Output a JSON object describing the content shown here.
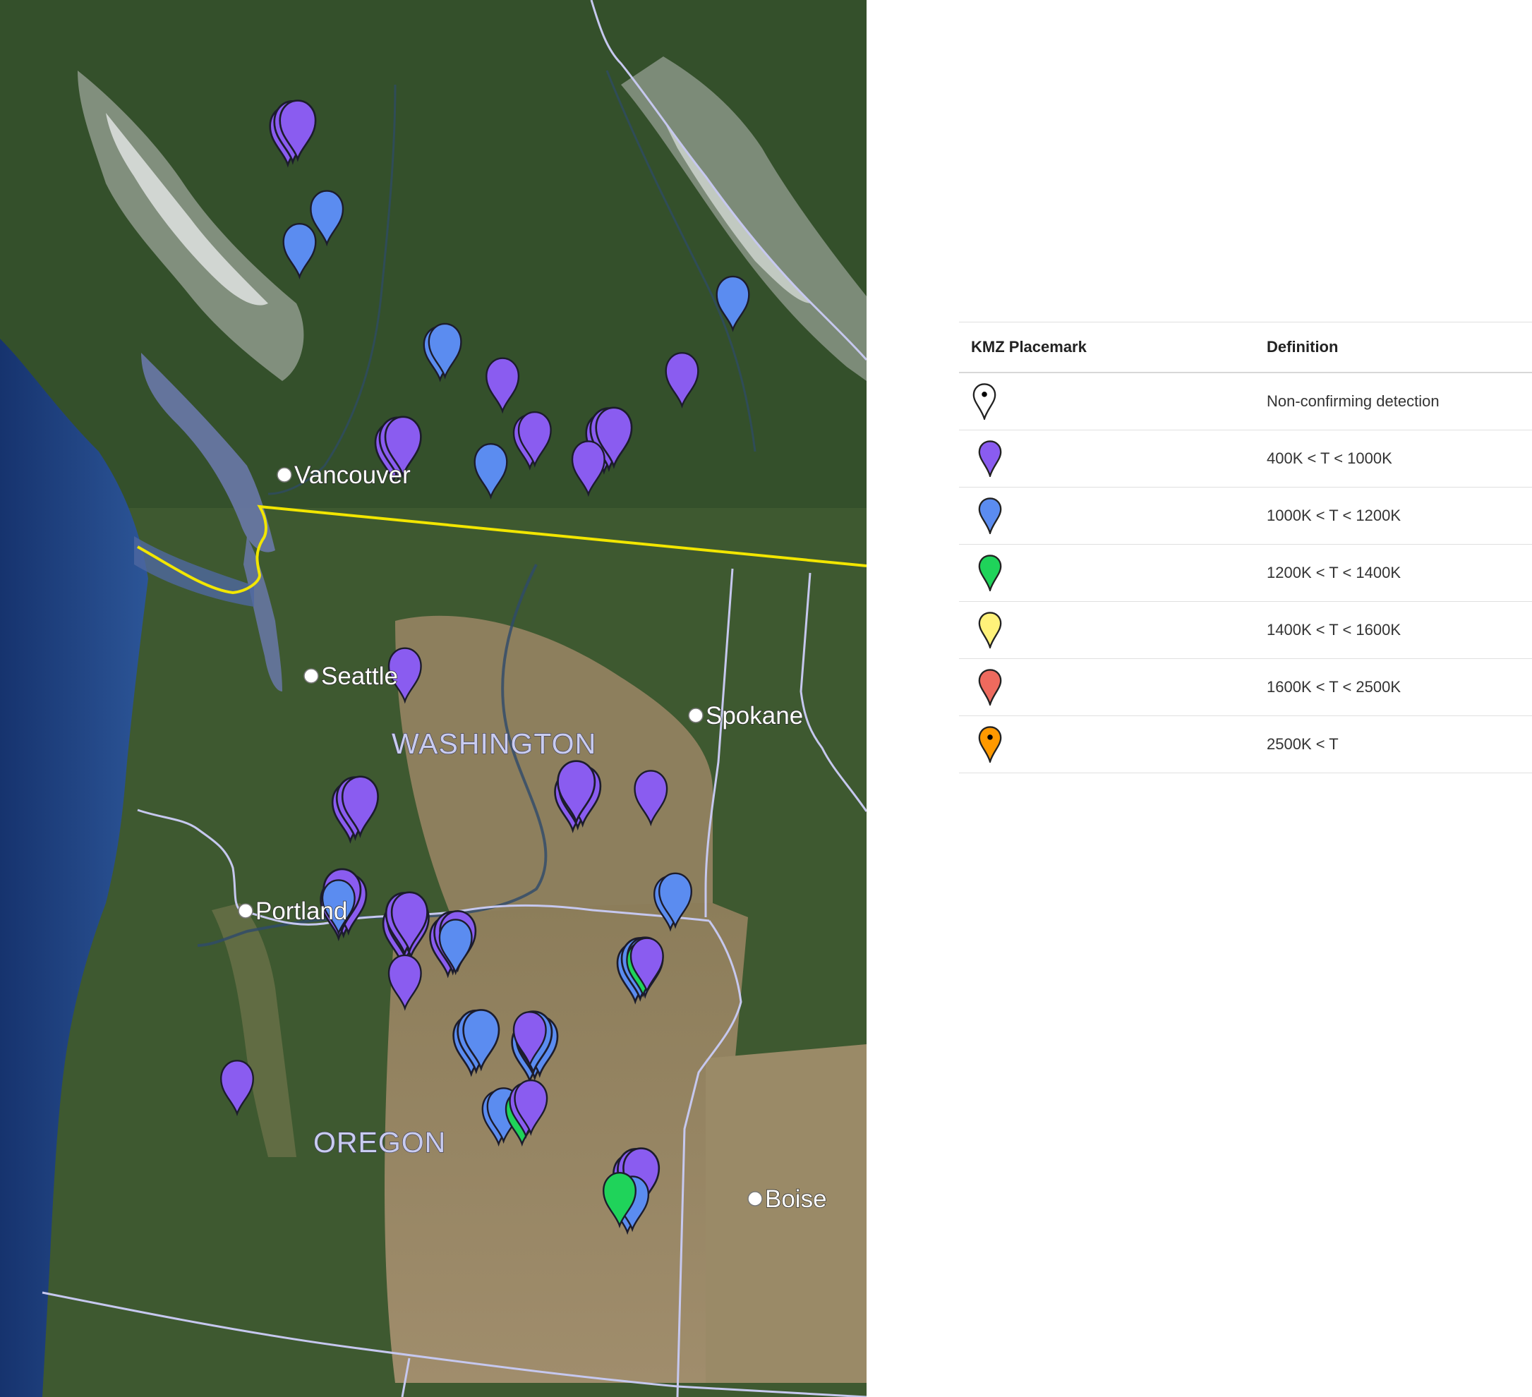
{
  "map": {
    "cities": [
      {
        "name": "Vancouver"
      },
      {
        "name": "Seattle"
      },
      {
        "name": "Spokane"
      },
      {
        "name": "Portland"
      },
      {
        "name": "Boise"
      }
    ],
    "states": [
      {
        "name": "WASHINGTON"
      },
      {
        "name": "OREGON"
      }
    ],
    "placemark_colors": {
      "purple": "#8a5cf0",
      "blue": "#5b8cf0",
      "green": "#1fd35a"
    },
    "placemarks": [
      {
        "lon": -123.05,
        "lat": 50.55,
        "cls": "purple",
        "count": 3
      },
      {
        "lon": -122.55,
        "lat": 49.95,
        "cls": "blue",
        "count": 1
      },
      {
        "lon": -122.9,
        "lat": 49.7,
        "cls": "blue",
        "count": 1
      },
      {
        "lon": -117.35,
        "lat": 49.3,
        "cls": "blue",
        "count": 1
      },
      {
        "lon": -121.1,
        "lat": 48.92,
        "cls": "blue",
        "count": 2
      },
      {
        "lon": -120.3,
        "lat": 48.68,
        "cls": "purple",
        "count": 1
      },
      {
        "lon": -118.0,
        "lat": 48.72,
        "cls": "purple",
        "count": 1
      },
      {
        "lon": -121.7,
        "lat": 48.15,
        "cls": "purple",
        "count": 3
      },
      {
        "lon": -119.95,
        "lat": 48.25,
        "cls": "purple",
        "count": 2
      },
      {
        "lon": -119.0,
        "lat": 48.22,
        "cls": "purple",
        "count": 3
      },
      {
        "lon": -120.45,
        "lat": 48.03,
        "cls": "blue",
        "count": 1
      },
      {
        "lon": -119.2,
        "lat": 48.05,
        "cls": "purple",
        "count": 1
      },
      {
        "lon": -121.55,
        "lat": 46.48,
        "cls": "purple",
        "count": 1
      },
      {
        "lon": -122.25,
        "lat": 45.42,
        "cls": "purple",
        "count": 3
      },
      {
        "lon": -119.4,
        "lat": 45.5,
        "cls": "purple",
        "count": 4
      },
      {
        "lon": -118.4,
        "lat": 45.55,
        "cls": "purple",
        "count": 1
      },
      {
        "lon": -122.4,
        "lat": 44.68,
        "cls": "purple",
        "count": 4
      },
      {
        "lon": -122.4,
        "lat": 44.72,
        "cls": "blue",
        "count": 1
      },
      {
        "lon": -121.6,
        "lat": 44.5,
        "cls": "purple",
        "count": 5
      },
      {
        "lon": -121.0,
        "lat": 44.4,
        "cls": "purple",
        "count": 3
      },
      {
        "lon": -120.9,
        "lat": 44.42,
        "cls": "blue",
        "count": 1
      },
      {
        "lon": -121.55,
        "lat": 44.15,
        "cls": "purple",
        "count": 1
      },
      {
        "lon": -118.15,
        "lat": 44.75,
        "cls": "blue",
        "count": 2
      },
      {
        "lon": -118.6,
        "lat": 44.2,
        "cls": "blue",
        "count": 3
      },
      {
        "lon": -118.5,
        "lat": 44.25,
        "cls": "green",
        "count": 1
      },
      {
        "lon": -118.45,
        "lat": 44.28,
        "cls": "purple",
        "count": 1
      },
      {
        "lon": -120.7,
        "lat": 43.65,
        "cls": "blue",
        "count": 3
      },
      {
        "lon": -119.95,
        "lat": 43.6,
        "cls": "blue",
        "count": 4
      },
      {
        "lon": -119.95,
        "lat": 43.72,
        "cls": "purple",
        "count": 1
      },
      {
        "lon": -120.35,
        "lat": 43.12,
        "cls": "blue",
        "count": 2
      },
      {
        "lon": -120.05,
        "lat": 43.12,
        "cls": "green",
        "count": 1
      },
      {
        "lon": -120.0,
        "lat": 43.18,
        "cls": "purple",
        "count": 2
      },
      {
        "lon": -118.65,
        "lat": 42.6,
        "cls": "purple",
        "count": 3
      },
      {
        "lon": -118.7,
        "lat": 42.45,
        "cls": "blue",
        "count": 2
      },
      {
        "lon": -118.8,
        "lat": 42.5,
        "cls": "green",
        "count": 1
      },
      {
        "lon": -123.7,
        "lat": 43.35,
        "cls": "purple",
        "count": 1
      }
    ]
  },
  "legend": {
    "col1_header": "KMZ Placemark",
    "col2_header": "Definition",
    "rows": [
      {
        "icon": "white-pin-icon",
        "color": "#ffffff",
        "dot": "#000000",
        "definition": "Non-confirming detection"
      },
      {
        "icon": "purple-pin-icon",
        "color": "#8a5cf0",
        "dot": "",
        "definition": "400K < T < 1000K"
      },
      {
        "icon": "blue-pin-icon",
        "color": "#5b8cf0",
        "dot": "",
        "definition": "1000K < T < 1200K"
      },
      {
        "icon": "green-pin-icon",
        "color": "#1fd35a",
        "dot": "",
        "definition": "1200K < T < 1400K"
      },
      {
        "icon": "yellow-pin-icon",
        "color": "#fff27a",
        "dot": "",
        "definition": "1400K < T < 1600K"
      },
      {
        "icon": "red-pin-icon",
        "color": "#ee6a5e",
        "dot": "",
        "definition": "1600K < T < 2500K"
      },
      {
        "icon": "orange-pin-icon",
        "color": "#ff9900",
        "dot": "#000000",
        "definition": "2500K < T"
      }
    ]
  }
}
